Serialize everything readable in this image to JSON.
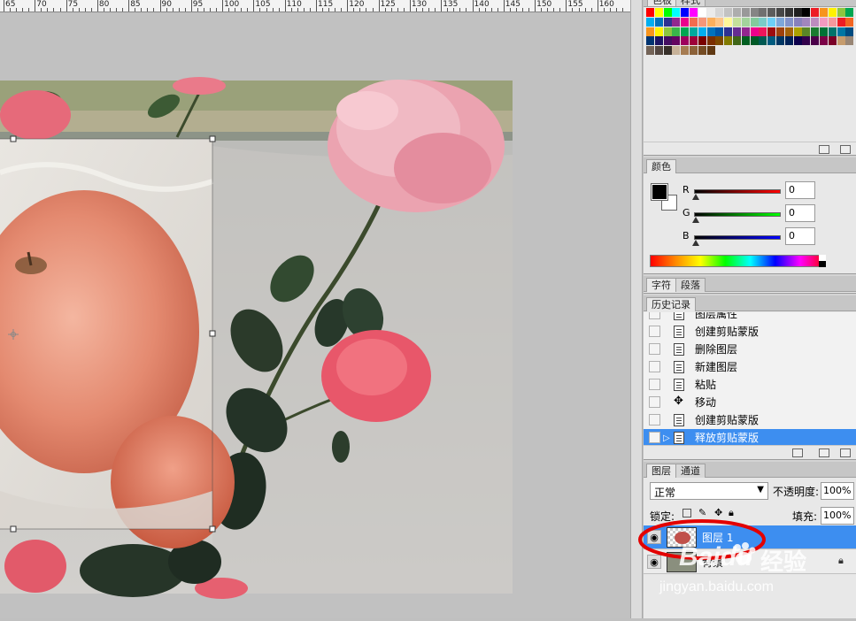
{
  "ruler": {
    "labels": [
      "65",
      "70",
      "75",
      "80",
      "85",
      "90",
      "95",
      "100",
      "105",
      "110",
      "115",
      "120",
      "125",
      "130",
      "135",
      "140",
      "145",
      "150",
      "155",
      "160"
    ]
  },
  "swatches": {
    "tab_labels": [
      "色板",
      "样式"
    ],
    "colors": [
      "#ff0000",
      "#ffff00",
      "#00ff00",
      "#00ffff",
      "#0000ff",
      "#ff00ff",
      "#ffffff",
      "#ebebeb",
      "#d6d6d6",
      "#c2c2c2",
      "#adadad",
      "#999999",
      "#858585",
      "#707070",
      "#5c5c5c",
      "#474747",
      "#333333",
      "#1f1f1f",
      "#000000",
      "#ed1c24",
      "#f7941d",
      "#fff200",
      "#8dc63f",
      "#00a651",
      "#00aeef",
      "#0072bc",
      "#2e3192",
      "#92278f",
      "#ec008c",
      "#f26c4f",
      "#f69679",
      "#fbaf5d",
      "#fdc689",
      "#fff799",
      "#c4df9b",
      "#a3d39c",
      "#82ca9c",
      "#7accc8",
      "#6dcff6",
      "#7da7d9",
      "#8393ca",
      "#8781bd",
      "#a186be",
      "#bd8cbf",
      "#f49ac1",
      "#f5989d",
      "#ed1c24",
      "#f26522",
      "#f7941d",
      "#fff200",
      "#8dc63f",
      "#39b54a",
      "#00a651",
      "#00a99d",
      "#00aeef",
      "#0072bc",
      "#0054a6",
      "#2e3192",
      "#662d91",
      "#92278f",
      "#ec008c",
      "#ed145b",
      "#9e0b0f",
      "#a0410d",
      "#a36209",
      "#aba000",
      "#598527",
      "#1a7b30",
      "#007236",
      "#00746b",
      "#0076a3",
      "#004b80",
      "#003471",
      "#1b1464",
      "#440e62",
      "#630460",
      "#9e005d",
      "#9e0039",
      "#790000",
      "#7b2e00",
      "#7d4900",
      "#827b00",
      "#406618",
      "#005e20",
      "#005826",
      "#005952",
      "#005b7f",
      "#003663",
      "#002157",
      "#0d004c",
      "#32004b",
      "#4b0049",
      "#7b0046",
      "#7a0026",
      "#c69c6d",
      "#998675",
      "#736357",
      "#534741",
      "#37302a",
      "#c7b299",
      "#a67c52",
      "#8c6239",
      "#754c24",
      "#603913"
    ]
  },
  "color_panel": {
    "tab_label": "颜色",
    "channels": [
      {
        "label": "R",
        "value": "0",
        "color": "#ff0000"
      },
      {
        "label": "G",
        "value": "0",
        "color": "#00ff00"
      },
      {
        "label": "B",
        "value": "0",
        "color": "#0000ff"
      }
    ]
  },
  "char_tabs": {
    "tab1": "字符",
    "tab2": "段落"
  },
  "history": {
    "tab_label": "历史记录",
    "items": [
      {
        "label": "图层属性",
        "icon": "document-icon"
      },
      {
        "label": "创建剪贴蒙版",
        "icon": "document-icon"
      },
      {
        "label": "删除图层",
        "icon": "document-icon"
      },
      {
        "label": "新建图层",
        "icon": "document-icon"
      },
      {
        "label": "粘贴",
        "icon": "document-icon"
      },
      {
        "label": "移动",
        "icon": "move-tool-icon"
      },
      {
        "label": "创建剪贴蒙版",
        "icon": "document-icon"
      },
      {
        "label": "释放剪贴蒙版",
        "icon": "document-icon",
        "selected": true
      }
    ]
  },
  "layers": {
    "tab1": "图层",
    "tab2": "通道",
    "blend_mode": "正常",
    "opacity_label": "不透明度:",
    "opacity_value": "100%",
    "lock_label": "锁定:",
    "fill_label": "填充:",
    "fill_value": "100%",
    "items": [
      {
        "name": "图层 1",
        "selected": true
      },
      {
        "name": "背景",
        "selected": false
      }
    ]
  },
  "watermark": {
    "brand": "Baidu",
    "brand_cn": "经验",
    "url": "jingyan.baidu.com"
  },
  "colors": {
    "selection_blue": "#3d8ef0",
    "annotation_red": "#e30000"
  }
}
